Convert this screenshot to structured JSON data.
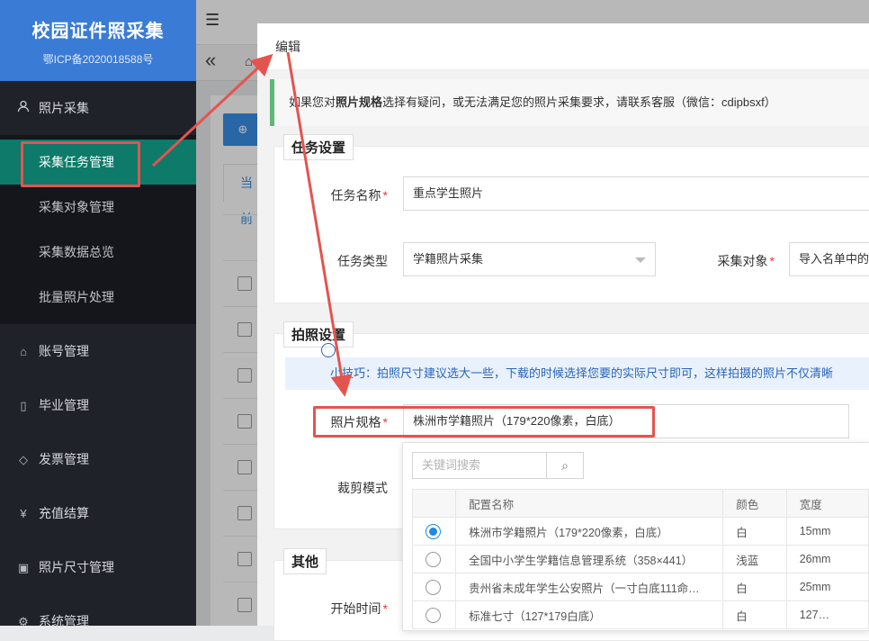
{
  "sidebar": {
    "brand_title": "校园证件照采集",
    "brand_sub": "鄂ICP备2020018588号",
    "photo_group": {
      "label": "照片采集",
      "icon": "user-icon"
    },
    "sub_items": [
      {
        "label": "采集任务管理",
        "active": true
      },
      {
        "label": "采集对象管理"
      },
      {
        "label": "采集数据总览"
      },
      {
        "label": "批量照片处理"
      }
    ],
    "items": [
      {
        "label": "账号管理",
        "icon": "home-icon"
      },
      {
        "label": "毕业管理",
        "icon": "document-icon"
      },
      {
        "label": "发票管理",
        "icon": "tag-icon"
      },
      {
        "label": "充值结算",
        "icon": "yen-icon"
      },
      {
        "label": "照片尺寸管理",
        "icon": "image-icon"
      },
      {
        "label": "系统管理",
        "icon": "gear-icon"
      }
    ]
  },
  "background": {
    "menu_icon": "☰",
    "back_icon": "«",
    "tab_label": "当前"
  },
  "modal": {
    "title": "编辑",
    "notice_pre": "如果您对",
    "notice_bold": "照片规格",
    "notice_post": "选择有疑问，或无法满足您的照片采集要求，请联系客服（微信：cdipbsxf）",
    "task_section": {
      "title": "任务设置",
      "name_label": "任务名称",
      "name_value": "重点学生照片",
      "type_label": "任务类型",
      "type_value": "学籍照片采集",
      "target_label": "采集对象",
      "target_value": "导入名单中的"
    },
    "photo_section": {
      "title": "拍照设置",
      "tip": "小技巧：拍照尺寸建议选大一些，下载的时候选择您要的实际尺寸即可，这样拍摄的照片不仅清晰",
      "spec_label": "照片规格",
      "spec_value": "株洲市学籍照片（179*220像素，白底）",
      "crop_label": "裁剪模式"
    },
    "other_section": {
      "title": "其他",
      "start_label": "开始时间"
    },
    "dropdown": {
      "search_placeholder": "关键词搜索",
      "columns": [
        "",
        "配置名称",
        "颜色",
        "宽度"
      ],
      "rows": [
        {
          "selected": true,
          "name": "株洲市学籍照片（179*220像素，白底）",
          "color": "白",
          "width": "15mm"
        },
        {
          "selected": false,
          "name": "全国中小学生学籍信息管理系统（358×441）",
          "color": "浅蓝",
          "width": "26mm"
        },
        {
          "selected": false,
          "name": "贵州省未成年学生公安照片（一寸白底111命…",
          "color": "白",
          "width": "25mm"
        },
        {
          "selected": false,
          "name": "标准七寸（127*179白底）",
          "color": "白",
          "width": "127…"
        }
      ]
    }
  },
  "annotation_color": "#e4544f"
}
